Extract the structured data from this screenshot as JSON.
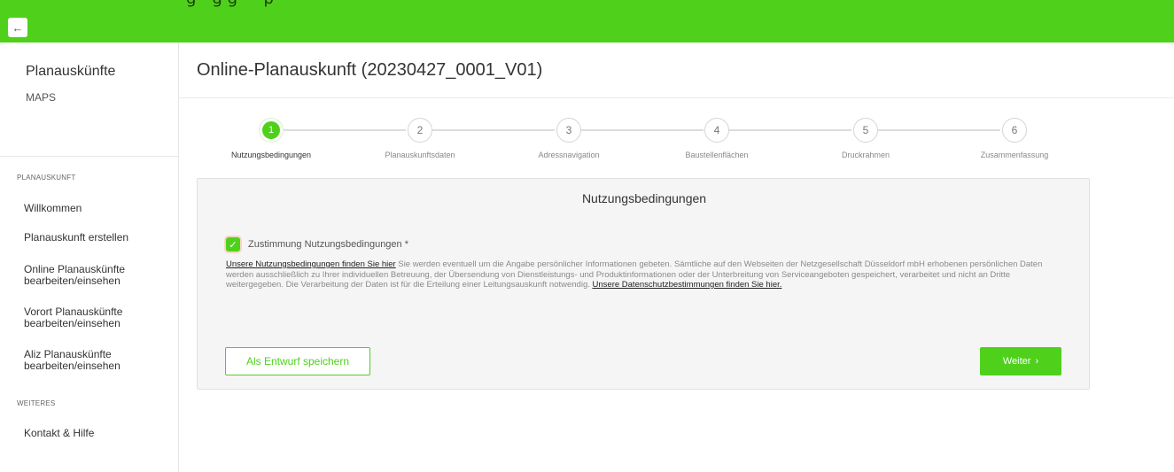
{
  "top_bar": {
    "clipped_text": "g—g g — p",
    "back_icon": "arrow-left-icon"
  },
  "sidebar": {
    "app_title": "Planauskünfte",
    "app_subtitle": "MAPS",
    "sections": [
      {
        "label": "PLANAUSKUNFT",
        "items": [
          {
            "label": "Willkommen"
          },
          {
            "label": "Planauskunft erstellen"
          },
          {
            "label": "Online Planauskünfte bearbeiten/einsehen"
          },
          {
            "label": "Vorort Planauskünfte bearbeiten/einsehen"
          },
          {
            "label": "Aliz Planauskünfte bearbeiten/einsehen"
          }
        ]
      },
      {
        "label": "WEITERES",
        "items": [
          {
            "label": "Kontakt & Hilfe"
          }
        ]
      }
    ]
  },
  "main": {
    "title": "Online-Planauskunft (20230427_0001_V01)",
    "steps": [
      {
        "number": "1",
        "label": "Nutzungsbedingungen",
        "active": true
      },
      {
        "number": "2",
        "label": "Planauskunftsdaten",
        "active": false
      },
      {
        "number": "3",
        "label": "Adressnavigation",
        "active": false
      },
      {
        "number": "4",
        "label": "Baustellenflächen",
        "active": false
      },
      {
        "number": "5",
        "label": "Druckrahmen",
        "active": false
      },
      {
        "number": "6",
        "label": "Zusammenfassung",
        "active": false
      }
    ],
    "card": {
      "title": "Nutzungsbedingungen",
      "checkbox_label": "Zustimmung Nutzungsbedingungen *",
      "checkbox_checked": true,
      "terms_link_1": "Unsere Nutzungsbedingungen finden Sie hier",
      "terms_text": " Sie werden eventuell um die Angabe persönlicher Informationen gebeten. Sämtliche auf den Webseiten der Netzgesellschaft Düsseldorf mbH erhobenen persönlichen Daten werden ausschließlich zu Ihrer individuellen Betreuung, der Übersendung von Dienstleistungs- und Produktinformationen oder der Unterbreitung von Serviceangeboten gespeichert, verarbeitet und nicht an Dritte weitergegeben. Die Verarbeitung der Daten ist für die Erteilung einer Leitungsauskunft notwendig. ",
      "terms_link_2": "Unsere Datenschutzbestimmungen finden Sie hier.",
      "draft_button": "Als Entwurf speichern",
      "next_button": "Weiter",
      "next_icon": "chevron-right-icon"
    }
  },
  "colors": {
    "brand_green": "#4fd11c",
    "card_background": "#f5f5f5"
  }
}
